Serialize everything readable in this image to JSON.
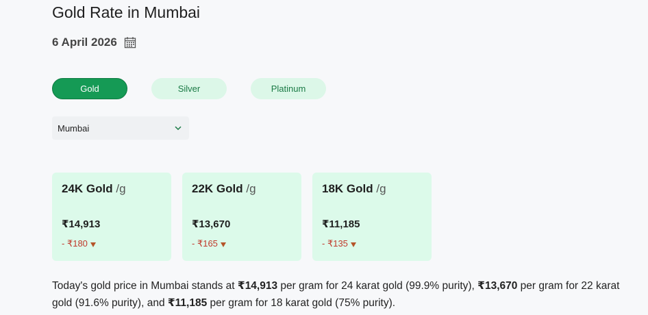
{
  "page_title": "Gold Rate in Mumbai",
  "date": "6 April 2026",
  "icons": {
    "calendar": "calendar-icon",
    "chevron": "chevron-down-icon",
    "down": "down-triangle-icon"
  },
  "tabs": [
    {
      "label": "Gold",
      "active": true
    },
    {
      "label": "Silver",
      "active": false
    },
    {
      "label": "Platinum",
      "active": false
    }
  ],
  "city_select": {
    "value": "Mumbai"
  },
  "cards": [
    {
      "title": "24K Gold",
      "unit": "/g",
      "price": "₹14,913",
      "change": "- ₹180"
    },
    {
      "title": "22K Gold",
      "unit": "/g",
      "price": "₹13,670",
      "change": "- ₹165"
    },
    {
      "title": "18K Gold",
      "unit": "/g",
      "price": "₹11,185",
      "change": "- ₹135"
    }
  ],
  "description": {
    "p1": "Today's gold price in Mumbai stands at ",
    "v24": "₹14,913",
    "p2": " per gram for 24 karat gold (99.9% purity), ",
    "v22": "₹13,670",
    "p3": " per gram for 22 karat gold (91.6% purity), and ",
    "v18": "₹11,185",
    "p4": " per gram for 18 karat gold (75% purity)."
  },
  "colors": {
    "accent": "#159a55",
    "tab_bg": "#dcf7e8",
    "card_bg": "#dcfaea",
    "negative": "#c0392b"
  }
}
